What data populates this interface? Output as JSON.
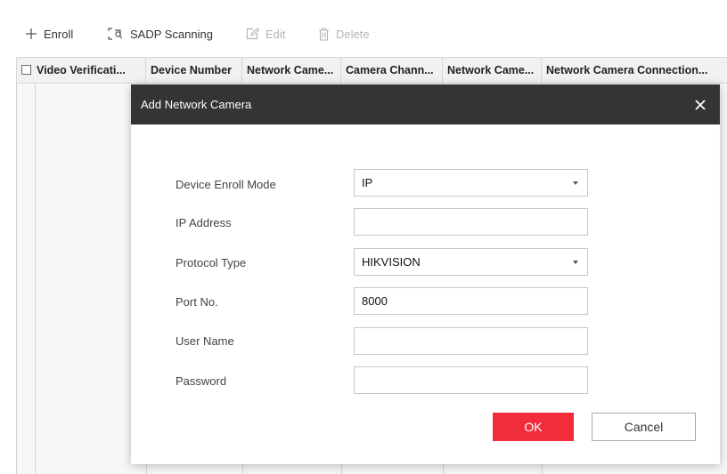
{
  "toolbar": {
    "enroll": "Enroll",
    "sadp": "SADP Scanning",
    "edit": "Edit",
    "delete": "Delete"
  },
  "table": {
    "columns": [
      "Video Verificati...",
      "Device Number",
      "Network Came...",
      "Camera Chann...",
      "Network Came...",
      "Network Camera Connection..."
    ]
  },
  "dialog": {
    "title": "Add Network Camera",
    "fields": {
      "enroll_mode": {
        "label": "Device Enroll Mode",
        "value": "IP"
      },
      "ip_address": {
        "label": "IP Address",
        "value": ""
      },
      "protocol": {
        "label": "Protocol Type",
        "value": "HIKVISION"
      },
      "port": {
        "label": "Port No.",
        "value": "8000"
      },
      "username": {
        "label": "User Name",
        "value": ""
      },
      "password": {
        "label": "Password",
        "value": ""
      }
    },
    "ok": "OK",
    "cancel": "Cancel"
  },
  "colors": {
    "ok_button": "#f12d3c",
    "dialog_header": "#343434"
  },
  "icons": [
    "plus-icon",
    "sadp-scan-icon",
    "edit-icon",
    "trash-icon",
    "close-icon",
    "caret-down-icon"
  ]
}
